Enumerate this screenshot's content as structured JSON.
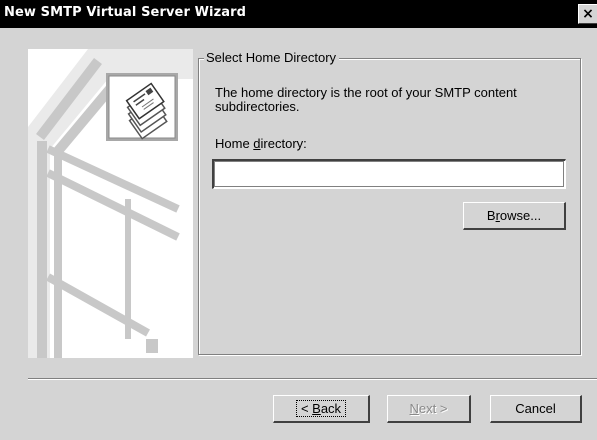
{
  "window": {
    "title": "New SMTP Virtual Server Wizard",
    "close_glyph": "×",
    "close_icon": "close-icon"
  },
  "page": {
    "section_title": "Select Home Directory",
    "description": "The home directory is the root of your SMTP content subdirectories.",
    "home_directory": {
      "label_pre": "Home ",
      "label_accel": "d",
      "label_post": "irectory:",
      "value": ""
    },
    "browse_button": {
      "pre": "B",
      "accel": "r",
      "post": "owse..."
    }
  },
  "buttons": {
    "back": {
      "arrow": "< ",
      "accel": "B",
      "post": "ack"
    },
    "next": {
      "pre": "",
      "accel": "N",
      "post": "ext >"
    },
    "cancel": "Cancel"
  },
  "illustration": {
    "icon": "envelope-stack-icon"
  },
  "colors": {
    "titlebar": "#000000",
    "dialog": "#d4d4d4"
  }
}
